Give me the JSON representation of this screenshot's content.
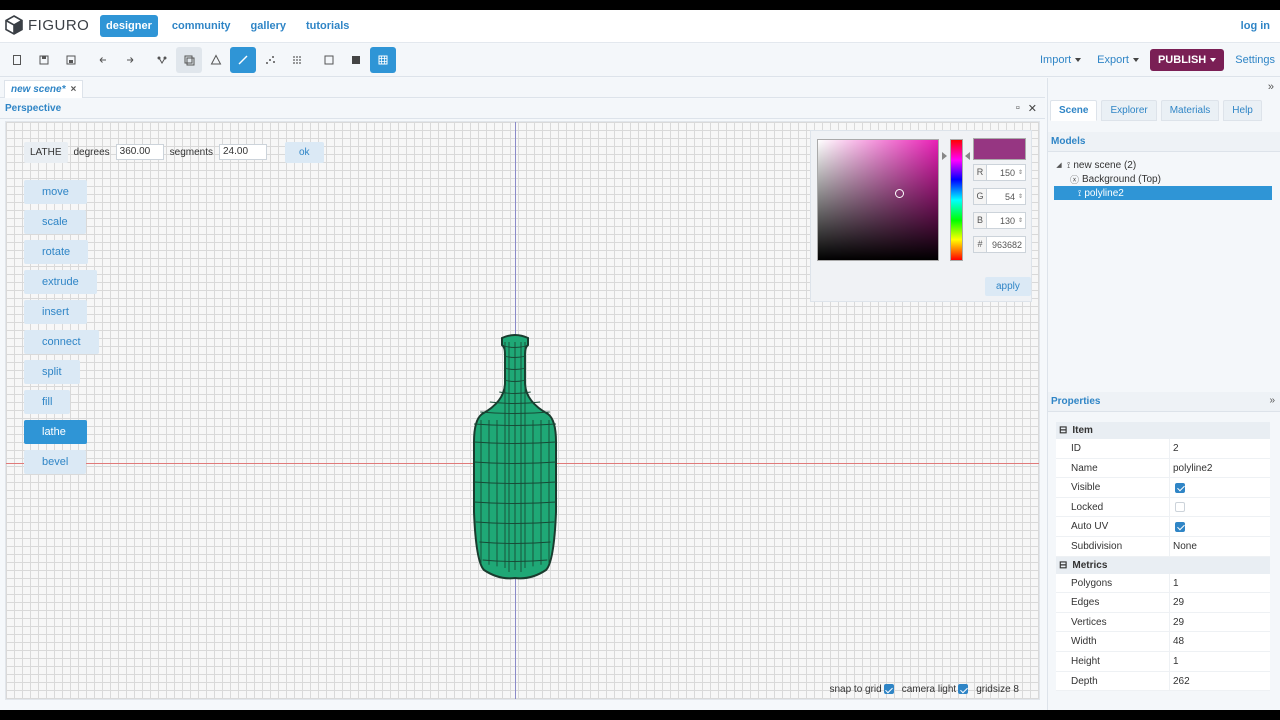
{
  "app": {
    "name": "FIGURO"
  },
  "nav": {
    "links": [
      "designer",
      "community",
      "gallery",
      "tutorials"
    ],
    "login": "log in"
  },
  "toolbar": {
    "import": "Import",
    "export": "Export",
    "publish": "PUBLISH",
    "settings": "Settings",
    "icons": [
      "new-file-icon",
      "save-icon",
      "save-as-icon",
      "undo-icon",
      "redo-icon",
      "select-vertex-icon",
      "select-edge-icon",
      "select-face-icon",
      "polyline-icon",
      "points-icon",
      "grid-points-icon",
      "wireframe-icon",
      "solid-icon",
      "texture-icon"
    ]
  },
  "document_tab": {
    "label": "new scene*",
    "close": "×"
  },
  "viewport": {
    "title": "Perspective",
    "lathe": {
      "label": "LATHE",
      "degrees_label": "degrees",
      "degrees": "360.00",
      "segments_label": "segments",
      "segments": "24.00",
      "ok": "ok"
    },
    "operations": [
      "move",
      "scale",
      "rotate",
      "extrude",
      "insert",
      "connect",
      "split",
      "fill",
      "lathe",
      "bevel"
    ],
    "active_operation": "lathe",
    "status": {
      "snap": "snap to grid",
      "camera": "camera light",
      "gridsize": "gridsize 8"
    }
  },
  "color_picker": {
    "r_label": "R",
    "r": "150",
    "g_label": "G",
    "g": "54",
    "b_label": "B",
    "b": "130",
    "hex_label": "#",
    "hex": "963682",
    "apply": "apply",
    "color": "#963682"
  },
  "right_panel": {
    "tabs": [
      "Scene",
      "Explorer",
      "Materials",
      "Help"
    ],
    "models_header": "Models",
    "tree": [
      "new scene (2)",
      "Background (Top)",
      "polyline2"
    ],
    "properties_header": "Properties",
    "item_group": "Item",
    "item_props": [
      {
        "k": "ID",
        "v": "2"
      },
      {
        "k": "Name",
        "v": "polyline2"
      },
      {
        "k": "Visible",
        "v": ""
      },
      {
        "k": "Locked",
        "v": ""
      },
      {
        "k": "Auto UV",
        "v": ""
      },
      {
        "k": "Subdivision",
        "v": "None"
      }
    ],
    "metrics_group": "Metrics",
    "metrics_props": [
      {
        "k": "Polygons",
        "v": "1"
      },
      {
        "k": "Edges",
        "v": "29"
      },
      {
        "k": "Vertices",
        "v": "29"
      },
      {
        "k": "Width",
        "v": "48"
      },
      {
        "k": "Height",
        "v": "1"
      },
      {
        "k": "Depth",
        "v": "262"
      }
    ]
  },
  "colors": {
    "accent": "#2f95d6",
    "publish": "#7a1f55",
    "model": "#1fa876"
  }
}
